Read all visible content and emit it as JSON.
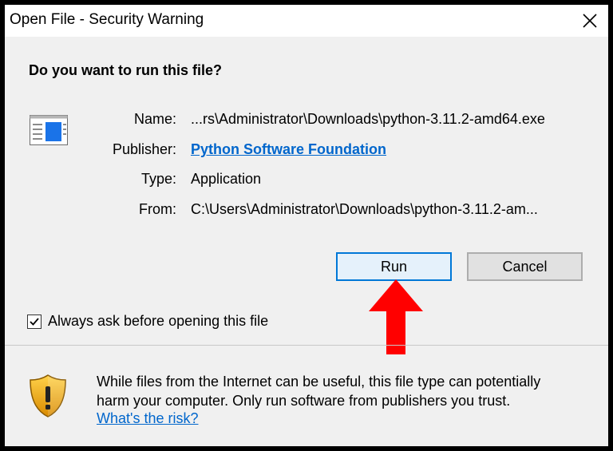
{
  "window": {
    "title": "Open File - Security Warning",
    "question": "Do you want to run this file?"
  },
  "file_info": {
    "name_label": "Name:",
    "name_value": "...rs\\Administrator\\Downloads\\python-3.11.2-amd64.exe",
    "publisher_label": "Publisher:",
    "publisher_value": "Python Software Foundation",
    "type_label": "Type:",
    "type_value": "Application",
    "from_label": "From:",
    "from_value": "C:\\Users\\Administrator\\Downloads\\python-3.11.2-am..."
  },
  "buttons": {
    "run_label": "Run",
    "cancel_label": "Cancel"
  },
  "checkbox": {
    "label": "Always ask before opening this file",
    "checked": true
  },
  "warning": {
    "line1": "While files from the Internet can be useful, this file type can potentially",
    "line2": "harm your computer. Only run software from publishers you trust.",
    "link_label": "What's the risk?"
  },
  "icons": {
    "close": "close-icon",
    "file": "application-file-icon",
    "arrow": "red-arrow-up-icon",
    "shield": "security-shield-icon"
  },
  "colors": {
    "link": "#0066cc",
    "run_border": "#0078d7",
    "run_bg": "#e5f1fb",
    "arrow": "#ff0000",
    "shield": "#f0a800"
  }
}
